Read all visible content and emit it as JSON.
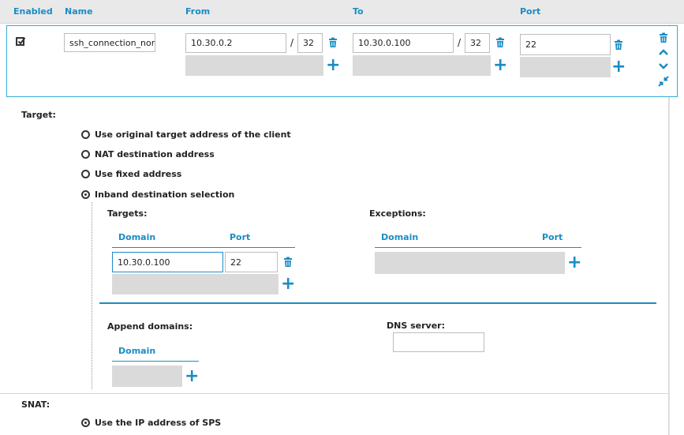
{
  "headers": {
    "enabled": "Enabled",
    "name": "Name",
    "from": "From",
    "to": "To",
    "port": "Port"
  },
  "row": {
    "name": "ssh_connection_nont",
    "from_ip": "10.30.0.2",
    "from_slash": "/",
    "from_mask": "32",
    "to_ip": "10.30.0.100",
    "to_slash": "/",
    "to_mask": "32",
    "port": "22"
  },
  "target": {
    "label": "Target:",
    "options": [
      "Use original target address of the client",
      "NAT destination address",
      "Use fixed address",
      "Inband destination selection"
    ],
    "selected": 3
  },
  "inband": {
    "targets_label": "Targets:",
    "exceptions_label": "Exceptions:",
    "domain_col": "Domain",
    "port_col": "Port",
    "target_domain": "10.30.0.100",
    "target_port": "22",
    "append_label": "Append domains:",
    "dns_label": "DNS server:",
    "dns_value": ""
  },
  "snat": {
    "label": "SNAT:",
    "option": "Use the IP address of SPS"
  },
  "colors": {
    "accent": "#1a8cc4",
    "border": "#35a9d8",
    "gray_box": "#dadada"
  }
}
